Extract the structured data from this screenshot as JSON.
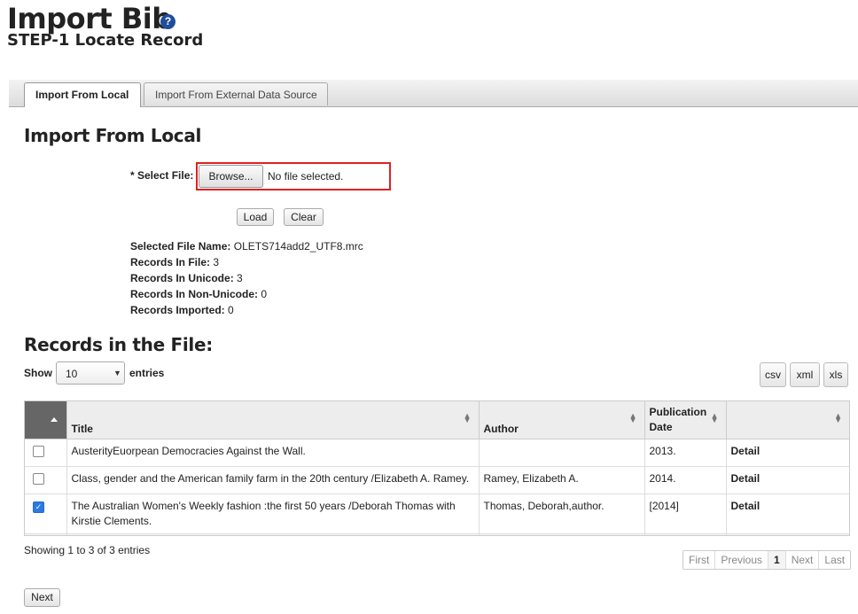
{
  "header": {
    "title": "Import Bib",
    "help_icon": "?",
    "subtitle": "STEP-1 Locate Record"
  },
  "tabs": [
    {
      "label": "Import From Local",
      "active": true
    },
    {
      "label": "Import From External Data Source",
      "active": false
    }
  ],
  "local": {
    "heading": "Import From Local",
    "select_file_label": "* Select File:",
    "browse_label": "Browse...",
    "file_status": "No file selected.",
    "load_label": "Load",
    "clear_label": "Clear",
    "info": [
      {
        "label": "Selected File Name:",
        "value": "OLETS714add2_UTF8.mrc"
      },
      {
        "label": "Records In File:",
        "value": "3"
      },
      {
        "label": "Records In Unicode:",
        "value": "3"
      },
      {
        "label": "Records In Non-Unicode:",
        "value": "0"
      },
      {
        "label": "Records Imported:",
        "value": "0"
      }
    ]
  },
  "records": {
    "heading": "Records in the File:",
    "show_label": "Show",
    "entries_value": "10",
    "entries_label": "entries",
    "export": {
      "csv": "csv",
      "xml": "xml",
      "xls": "xls"
    },
    "columns": [
      "Title",
      "Author",
      "Publication Date",
      ""
    ],
    "rows": [
      {
        "checked": false,
        "title": "AusterityEuorpean Democracies Against the Wall.",
        "author": "",
        "date": "2013.",
        "action": "Detail"
      },
      {
        "checked": false,
        "title": "Class, gender and the American family farm in the 20th century /Elizabeth A. Ramey.",
        "author": "Ramey, Elizabeth A.",
        "date": "2014.",
        "action": "Detail"
      },
      {
        "checked": true,
        "title": "The Australian Women's Weekly fashion :the first 50 years /Deborah Thomas with Kirstie Clements.",
        "author": "Thomas, Deborah,author.",
        "date": "[2014]",
        "action": "Detail"
      }
    ],
    "showing": "Showing 1 to 3 of 3 entries",
    "pager": {
      "first": "First",
      "previous": "Previous",
      "current": "1",
      "next": "Next",
      "last": "Last"
    }
  },
  "footer": {
    "next_label": "Next"
  },
  "colors": {
    "accent": "#1f4e9a",
    "highlight_border": "#dd2222",
    "checkbox_on": "#2a7ae2"
  }
}
